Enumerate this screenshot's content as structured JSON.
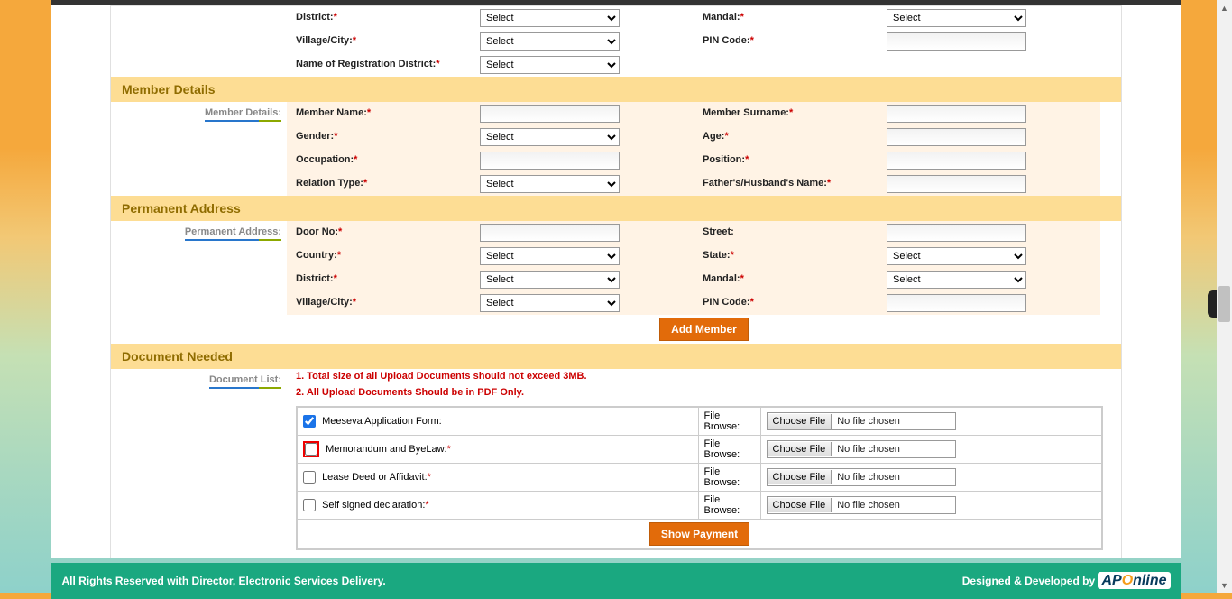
{
  "opts": {
    "select": "Select"
  },
  "top": {
    "district": "District:",
    "mandal": "Mandal:",
    "village": "Village/City:",
    "pin": "PIN Code:",
    "regdist": "Name of Registration District:"
  },
  "member": {
    "section": "Member Details",
    "side": "Member Details:",
    "name": "Member Name:",
    "surname": "Member Surname:",
    "gender": "Gender:",
    "age": "Age:",
    "occupation": "Occupation:",
    "position": "Position:",
    "reltype": "Relation Type:",
    "father": "Father's/Husband's Name:"
  },
  "perm": {
    "section": "Permanent Address",
    "side": "Permanent Address:",
    "door": "Door No:",
    "street": "Street:",
    "country": "Country:",
    "state": "State:",
    "district": "District:",
    "mandal": "Mandal:",
    "village": "Village/City:",
    "pin": "PIN Code:"
  },
  "addmember": "Add Member",
  "doc": {
    "section": "Document Needed",
    "side": "Document List:",
    "note1": "1. Total size of all Upload Documents should not exceed 3MB.",
    "note2": "2. All Upload Documents Should be in PDF Only.",
    "browse": "File Browse:",
    "choose": "Choose File",
    "nofile": "No file chosen",
    "row1": "Meeseva Application Form:",
    "row2": "Memorandum and ByeLaw:",
    "row3": "Lease Deed or Affidavit:",
    "row4": "Self signed declaration:"
  },
  "showpayment": "Show Payment",
  "footer": {
    "left": "All Rights Reserved with Director, Electronic Services Delivery.",
    "right": "Designed & Developed by "
  }
}
